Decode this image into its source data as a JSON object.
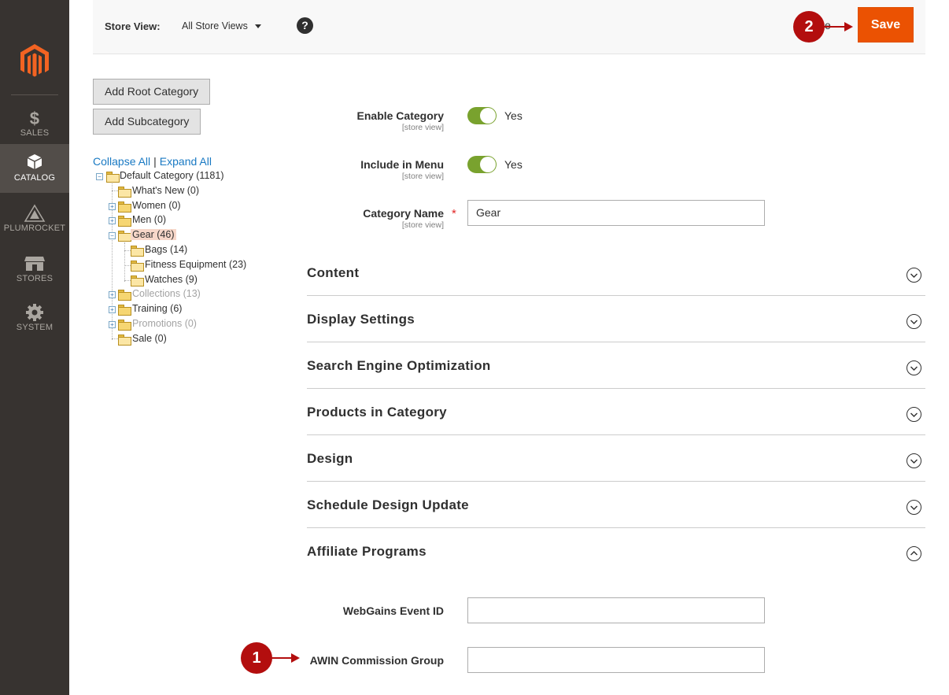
{
  "sidebar": {
    "items": [
      {
        "label": "SALES",
        "icon": "dollar-icon",
        "active": false
      },
      {
        "label": "CATALOG",
        "icon": "box-icon",
        "active": true
      },
      {
        "label": "PLUMROCKET",
        "icon": "plumrocket-icon",
        "active": false
      },
      {
        "label": "STORES",
        "icon": "store-icon",
        "active": false
      },
      {
        "label": "SYSTEM",
        "icon": "gear-icon",
        "active": false
      }
    ]
  },
  "topbar": {
    "store_view_label": "Store View:",
    "store_view_value": "All Store Views",
    "help": "?",
    "save_label": "Save",
    "hidden_text": "e"
  },
  "markers": {
    "one": "1",
    "two": "2"
  },
  "tree": {
    "add_root": "Add Root Category",
    "add_sub": "Add Subcategory",
    "collapse_all": "Collapse All",
    "separator": "|",
    "expand_all": "Expand All",
    "nodes": [
      {
        "label": "Default Category (1181)"
      },
      {
        "label": "What's New (0)"
      },
      {
        "label": "Women (0)"
      },
      {
        "label": "Men (0)"
      },
      {
        "label": "Gear (46)"
      },
      {
        "label": "Bags (14)"
      },
      {
        "label": "Fitness Equipment (23)"
      },
      {
        "label": "Watches (9)"
      },
      {
        "label": "Collections (13)"
      },
      {
        "label": "Training (6)"
      },
      {
        "label": "Promotions (0)"
      },
      {
        "label": "Sale (0)"
      }
    ]
  },
  "form": {
    "enable_category": {
      "label": "Enable Category",
      "scope": "[store view]",
      "value": "Yes"
    },
    "include_in_menu": {
      "label": "Include in Menu",
      "scope": "[store view]",
      "value": "Yes"
    },
    "category_name": {
      "label": "Category Name",
      "scope": "[store view]",
      "value": "Gear",
      "required": "*"
    }
  },
  "sections": [
    {
      "title": "Content",
      "expanded": false
    },
    {
      "title": "Display Settings",
      "expanded": false
    },
    {
      "title": "Search Engine Optimization",
      "expanded": false
    },
    {
      "title": "Products in Category",
      "expanded": false
    },
    {
      "title": "Design",
      "expanded": false
    },
    {
      "title": "Schedule Design Update",
      "expanded": false
    },
    {
      "title": "Affiliate Programs",
      "expanded": true
    }
  ],
  "affiliate": {
    "webgains_label": "WebGains Event ID",
    "webgains_value": "",
    "awin_label": "AWIN Commission Group",
    "awin_value": ""
  },
  "colors": {
    "sidebar_bg": "#373330",
    "sidebar_active": "#524d49",
    "brand_orange": "#eb5202",
    "toggle_on": "#79a22e",
    "link_blue": "#1979c3",
    "marker_red": "#b30e0e"
  }
}
